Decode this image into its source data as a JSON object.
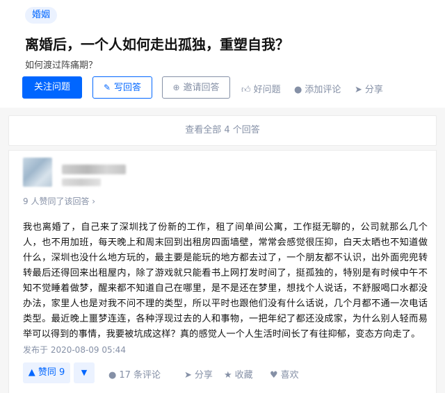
{
  "question": {
    "topic": "婚姻",
    "title": "离婚后，一个人如何走出孤独，重塑自我？",
    "detail": "如何渡过阵痛期？",
    "buttons": {
      "follow": "关注问题",
      "write": "写回答",
      "invite": "邀请回答"
    },
    "actions": {
      "good_question": "好问题",
      "add_comment": "添加评论",
      "share": "分享"
    }
  },
  "view_all": "查看全部 4 个回答",
  "answer": {
    "voters": "9 人赞同了该回答 ›",
    "content": "我也离婚了，自己来了深圳找了份新的工作，租了间单间公寓，工作挺无聊的，公司就那么几个人，也不用加班，每天晚上和周末回到出租房四面墙壁，常常会感觉很压抑，白天太晒也不知道做什么，深圳也没什么地方玩的，最主要是能玩的地方都去过了，一个朋友都不认识，出外面兜兜转转最后还得回来出租屋内，除了游戏就只能看书上网打发时间了，挺孤独的，特别是有时候中午不知不觉睡着做梦，醒来都不知道自己在哪里，是不是还在梦里，想找个人说话，不舒服喝口水都没办法，家里人也是对我不问不理的类型，所以平时也跟他们没有什么话说，几个月都不通一次电话类型。最近晚上噩梦连连，各种浮现过去的人和事物，一把年纪了都还没成家，为什么别人轻而易举可以得到的事情，我要被坑成这样？真的感觉人一个人生活时间长了有往抑郁，变态方向走了。",
    "published": "发布于 2020-08-09 05:44",
    "vote_up": "▲ 赞同 9",
    "vote_down": "▼",
    "actions": {
      "comments": "17 条评论",
      "share": "分享",
      "collect": "收藏",
      "like": "喜欢"
    }
  },
  "colors": {
    "primary": "#0066ff",
    "tag_bg": "#ebf2ff",
    "muted": "#8590a6",
    "page_bg": "#f6f6f6"
  },
  "icons": {
    "write": "pencil-icon",
    "invite": "invite-user-icon",
    "good_question": "thumb-up-icon",
    "add_comment": "comment-bubble-icon",
    "share": "paper-plane-icon",
    "collect": "star-icon",
    "like": "heart-icon"
  }
}
